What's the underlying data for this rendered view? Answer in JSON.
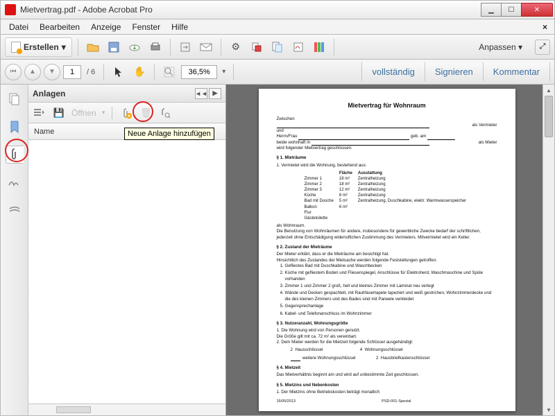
{
  "window": {
    "title": "Mietvertrag.pdf - Adobe Acrobat Pro"
  },
  "menu": {
    "file": "Datei",
    "edit": "Bearbeiten",
    "view": "Anzeige",
    "window": "Fenster",
    "help": "Hilfe"
  },
  "toolbar": {
    "create": "Erstellen",
    "customize": "Anpassen",
    "icons": {
      "open": "open-icon",
      "save": "save-icon",
      "cloud": "cloud-icon",
      "print": "print-icon",
      "share": "share-icon",
      "mail": "mail-icon",
      "settings": "gear-icon",
      "convert": "convert-icon",
      "combine": "combine-icon",
      "sign": "sign-icon",
      "multimedia": "multimedia-icon"
    }
  },
  "nav": {
    "page_current": "1",
    "page_total": "/ 6",
    "zoom": "36,5%",
    "fit": "vollständig",
    "sign": "Signieren",
    "comment": "Kommentar"
  },
  "rail": {
    "items": [
      "pages",
      "bookmarks",
      "attachments",
      "signatures",
      "layers"
    ]
  },
  "panel": {
    "title": "Anlagen",
    "open": "Öffnen",
    "tooltip_add": "Neue Anlage hinzufügen",
    "col_name": "Name"
  },
  "doc": {
    "title": "Mietvertrag für Wohnraum",
    "between": "Zwischen",
    "and": "und",
    "herr_frau": "Herrn/Frau",
    "as_landlord": "als Vermieter",
    "geb_am": "geb. am",
    "residing": "beide wohnhaft in",
    "as_tenant": "als Mieter",
    "concluded": "wird folgender Mietvertrag geschlossen:",
    "s1": "§ 1.   Mieträume",
    "s1_1": "1.  Vermietet wird die Wohnung, bestehend aus:",
    "tbl_hdr": {
      "area": "Fläche",
      "equip": "Ausstattung"
    },
    "rooms": [
      {
        "name": "Zimmer 1",
        "area": "18 m²",
        "equip": "Zentralheizung"
      },
      {
        "name": "Zimmer 2",
        "area": "18 m²",
        "equip": "Zentralheizung"
      },
      {
        "name": "Zimmer 3",
        "area": "12 m²",
        "equip": "Zentralheizung"
      },
      {
        "name": "Küche",
        "area": "8 m²",
        "equip": "Zentralheizung"
      },
      {
        "name": "Bad mit Dusche",
        "area": "5 m²",
        "equip": "Zentralheizung, Duschkabine, elektr. Warmwasserspeicher"
      },
      {
        "name": "Balkon",
        "area": "6 m²",
        "equip": ""
      },
      {
        "name": "Flur",
        "area": "",
        "equip": ""
      },
      {
        "name": "Gästetoilette",
        "area": "",
        "equip": ""
      }
    ],
    "as_living": "als Wohnraum.",
    "s1_note": "Die Benutzung von Wohnräumen für andere, insbesondere für gewerbliche Zwecke bedarf der schriftlichen, jederzeit ohne Entschädigung widerruflichen Zustimmung des Vermieters. Mitvermietet wird ein Keller.",
    "s2": "§ 2.   Zustand der Mieträume",
    "s2_intro1": "Der Mieter erklärt, dass er die Mieträume am              besichtigt hat.",
    "s2_intro2": "Hinsichtlich des Zustandes der Mietsache werden folgende Feststellungen getroffen:",
    "s2_items": [
      "Gefliestes Bad mit Duschkabine und Waschbecken",
      "Küche mit gefliestem Boden und Fliesenspiegel, Anschlüsse für Elektroherd, Waschmaschine und Spüle vorhanden",
      "Zimmer 1 und Zimmer 2 groß, hell und kleines Zimmer mit Laminat neu verlegt",
      "Wände und Decken gespachtelt, mit Rauhfasertapete tapeziert und weiß gestrichen, Wohnzimmerdecke und die des kleinen Zimmers und des Bades sind mit Paneele verkleidet",
      "Gegensprechanlage",
      "Kabel- und Telefonanschluss im Wohnzimmer"
    ],
    "s3": "§ 3.   Nutzeranzahl, Wohnungsgröße",
    "s3_1": "1.  Die Wohnung wird von          Personen genutzt.",
    "s3_2": "     Die Größe gilt mit ca. 72 m² als vereinbart.",
    "s3_3": "2.  Dem Mieter werden für die Mietzeit folgende Schlüssel ausgehändigt:",
    "keys": [
      {
        "n": "2",
        "label": "Hausschlüssel"
      },
      {
        "n": "4",
        "label": "Wohnungsschlüssel"
      },
      {
        "n2": "",
        "label2": "weitere Wohnungsschlüssel"
      },
      {
        "n3": "2",
        "label3": "Hausbriefkastenschlüssel"
      }
    ],
    "s4": "§ 4.   Mietzeit",
    "s4_1": "Das Mietverhältnis beginnt am                        und wird auf unbestimmte Zeit geschlossen.",
    "s5": "§ 5.   Mietzins und Nebenkosten",
    "s5_1": "1.  Der Mietzins ohne Betriebskosten beträgt monatlich",
    "footer_date": "15/05/2013",
    "footer_code": "PSD-001-Spezial"
  }
}
